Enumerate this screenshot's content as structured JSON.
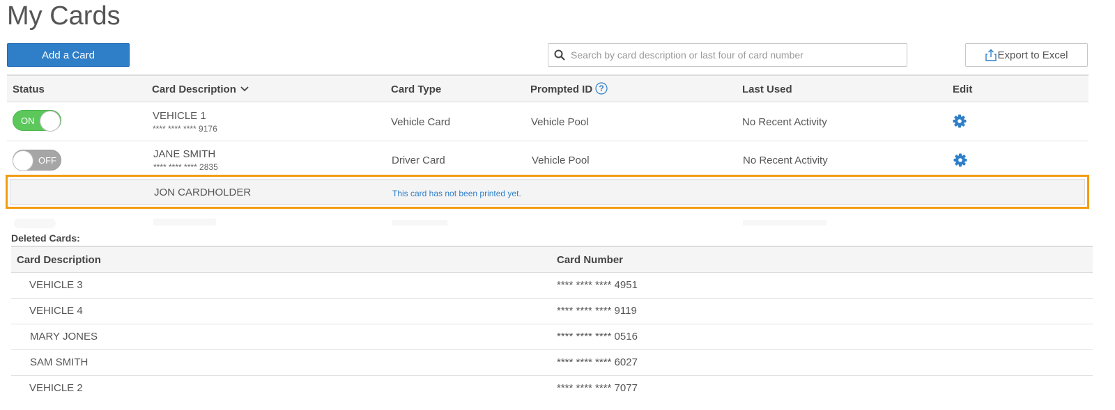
{
  "page": {
    "title": "My Cards"
  },
  "toolbar": {
    "add_label": "Add a Card",
    "search_placeholder": "Search by card description or last four of card number",
    "search_value": "",
    "export_label": "Export to Excel"
  },
  "table": {
    "headers": {
      "status": "Status",
      "description": "Card Description",
      "type": "Card Type",
      "prompted": "Prompted ID",
      "last_used": "Last Used",
      "edit": "Edit"
    },
    "rows": [
      {
        "status": "ON",
        "name": "VEHICLE 1",
        "number": "**** **** **** 9176",
        "type": "Vehicle Card",
        "prompted": "Vehicle Pool",
        "last_used": "No Recent Activity"
      },
      {
        "status": "OFF",
        "name": "JANE SMITH",
        "number": "**** **** **** 2835",
        "type": "Driver Card",
        "prompted": "Vehicle Pool",
        "last_used": "No Recent Activity"
      },
      {
        "name": "JON CARDHOLDER",
        "note": "This card has not been printed yet."
      }
    ]
  },
  "deleted": {
    "label": "Deleted Cards:",
    "headers": {
      "description": "Card Description",
      "number": "Card Number"
    },
    "rows": [
      {
        "name": "VEHICLE 3",
        "number": "**** **** **** 4951"
      },
      {
        "name": "VEHICLE 4",
        "number": "**** **** **** 9119"
      },
      {
        "name": "MARY JONES",
        "number": "**** **** **** 0516"
      },
      {
        "name": "SAM SMITH",
        "number": "**** **** **** 6027"
      },
      {
        "name": "VEHICLE 2",
        "number": "**** **** **** 7077"
      }
    ]
  },
  "colors": {
    "primary": "#2f7fc8",
    "toggle_on": "#5cc85c",
    "toggle_off": "#a6a6a6",
    "highlight": "#f39c12",
    "link": "#2f7fc8"
  },
  "icons": {
    "search": "search-icon",
    "export": "export-icon",
    "sort": "chevron-down-icon",
    "help": "help-icon",
    "edit": "gear-icon"
  }
}
